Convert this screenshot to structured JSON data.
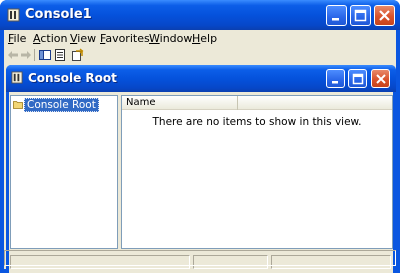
{
  "window": {
    "title": "Console1"
  },
  "menubar": {
    "items": [
      "File",
      "Action",
      "View",
      "Favorites",
      "Window",
      "Help"
    ]
  },
  "toolbar": {
    "buttons": [
      "back-arrow-icon",
      "forward-arrow-icon",
      "show-hide-tree-icon",
      "properties-icon",
      "export-icon"
    ]
  },
  "child_window": {
    "title": "Console Root",
    "tree": {
      "items": [
        {
          "label": "Console Root",
          "selected": true
        }
      ]
    },
    "list": {
      "columns": [
        "Name"
      ],
      "empty_message": "There are no items to show in this view."
    }
  },
  "colors": {
    "titlebar": "#0552dc",
    "client": "#ece9d8",
    "selection": "#316ac5",
    "close_button": "#d9532c"
  }
}
